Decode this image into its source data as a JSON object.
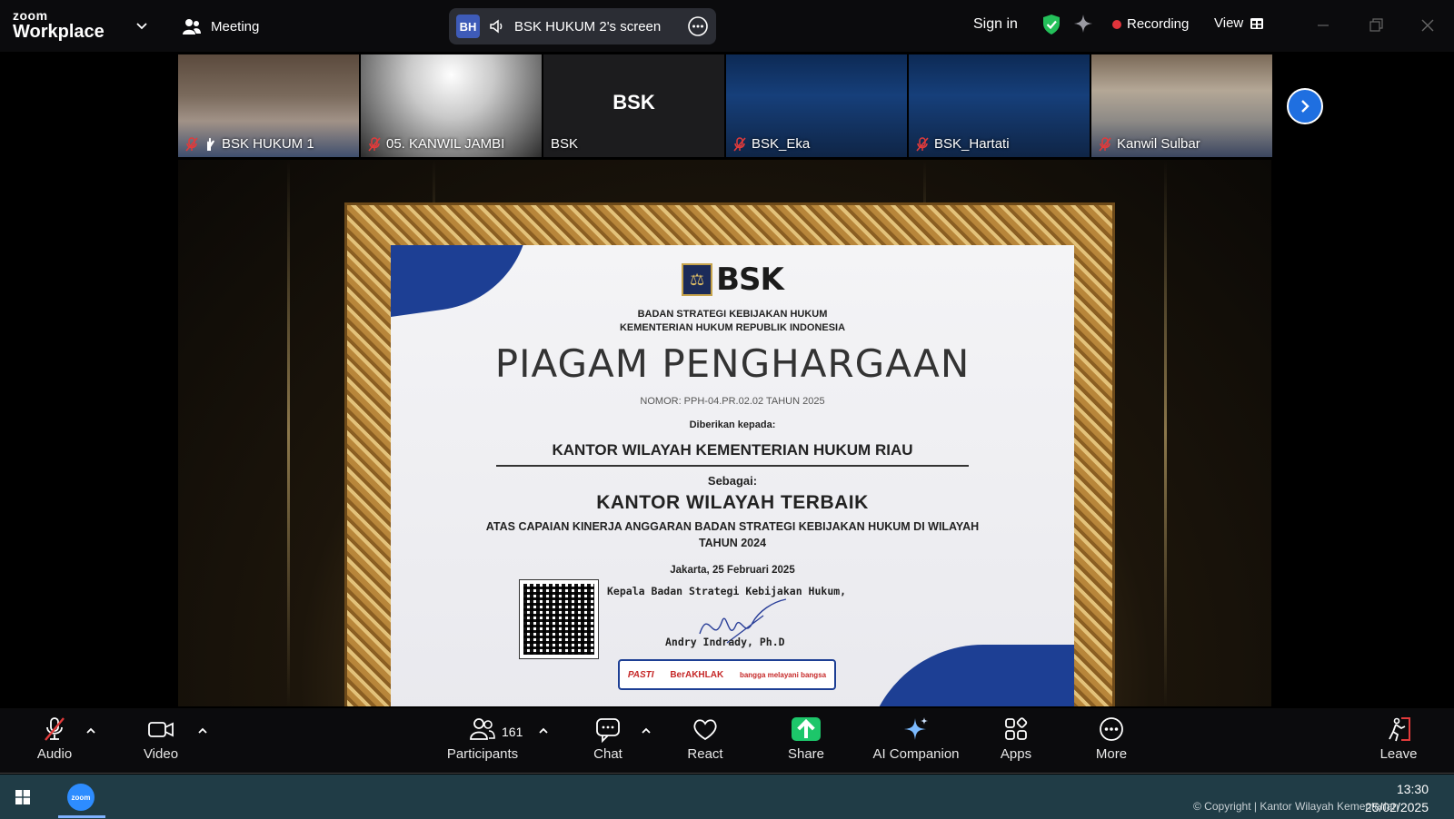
{
  "app": {
    "logo_top": "zoom",
    "logo_bottom": "Workplace"
  },
  "header": {
    "meeting_label": "Meeting",
    "share_initials": "BH",
    "share_title": "BSK HUKUM 2's screen",
    "sign_in": "Sign in",
    "recording": "Recording",
    "view": "View",
    "colors": {
      "accent": "#24d07a",
      "recording": "#e0343b",
      "pill": "#2b2d34"
    }
  },
  "participants_strip": [
    {
      "name": "BSK HUKUM 1",
      "muted": true,
      "active": true
    },
    {
      "name": "05. KANWIL JAMBI",
      "muted": true
    },
    {
      "name": "BSK",
      "muted": false,
      "placeholder": "BSK"
    },
    {
      "name": "BSK_Eka",
      "muted": true
    },
    {
      "name": "BSK_Hartati",
      "muted": true
    },
    {
      "name": "Kanwil Sulbar",
      "muted": true
    }
  ],
  "certificate": {
    "logo_text": "BSK",
    "org_line1": "BADAN STRATEGI KEBIJAKAN HUKUM",
    "org_line2": "KEMENTERIAN HUKUM REPUBLIK INDONESIA",
    "title": "PIAGAM PENGHARGAAN",
    "number": "NOMOR: PPH-04.PR.02.02 TAHUN 2025",
    "given_to": "Diberikan kepada:",
    "recipient": "KANTOR WILAYAH KEMENTERIAN HUKUM RIAU",
    "as_label": "Sebagai:",
    "award": "KANTOR WILAYAH TERBAIK",
    "reason_line1": "ATAS CAPAIAN KINERJA ANGGARAN BADAN STRATEGI KEBIJAKAN HUKUM DI WILAYAH",
    "reason_line2": "TAHUN 2024",
    "place_date": "Jakarta, 25 Februari 2025",
    "head_title": "Kepala Badan Strategi Kebijakan Hukum,",
    "signer": "Andry Indrady, Ph.D",
    "badge1": "PASTI",
    "badge2": "BerAKHLAK",
    "badge3": "bangga melayani bangsa"
  },
  "toolbar": {
    "audio": "Audio",
    "video": "Video",
    "participants": "Participants",
    "participants_count": "161",
    "chat": "Chat",
    "react": "React",
    "share": "Share",
    "ai": "AI Companion",
    "apps": "Apps",
    "more": "More",
    "leave": "Leave"
  },
  "taskbar": {
    "zoom_icon_text": "zoom",
    "time": "13:30",
    "date": "25/02/2025",
    "copyright": "© Copyright | Kantor Wilayah Kementerian"
  }
}
